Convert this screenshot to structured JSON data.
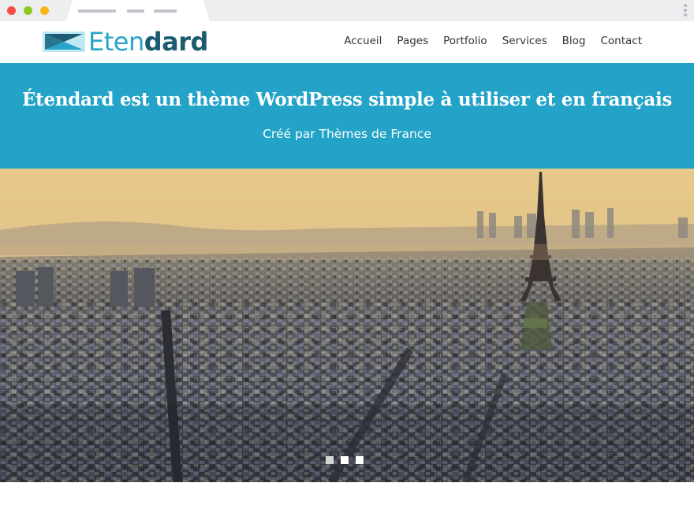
{
  "browser": {
    "window_controls": [
      "close",
      "minimize",
      "maximize"
    ],
    "menu_icon": "kebab-menu-icon"
  },
  "header": {
    "logo": {
      "text_light": "Eten",
      "text_dark": "dard",
      "icon": "flag-logo-icon"
    },
    "nav": [
      {
        "label": "Accueil"
      },
      {
        "label": "Pages"
      },
      {
        "label": "Portfolio"
      },
      {
        "label": "Services"
      },
      {
        "label": "Blog"
      },
      {
        "label": "Contact"
      }
    ]
  },
  "banner": {
    "title": "Étendard est un thème WordPress simple à utiliser et en français",
    "subtitle": "Créé par Thèmes de France"
  },
  "hero": {
    "image_subject": "Aerial view of Paris with the Eiffel Tower at sunset",
    "slides_total": 3,
    "active_slide": 1
  },
  "colors": {
    "brand": "#24a3c9",
    "brand_dark": "#1b5a70",
    "nav_text": "#333333"
  }
}
